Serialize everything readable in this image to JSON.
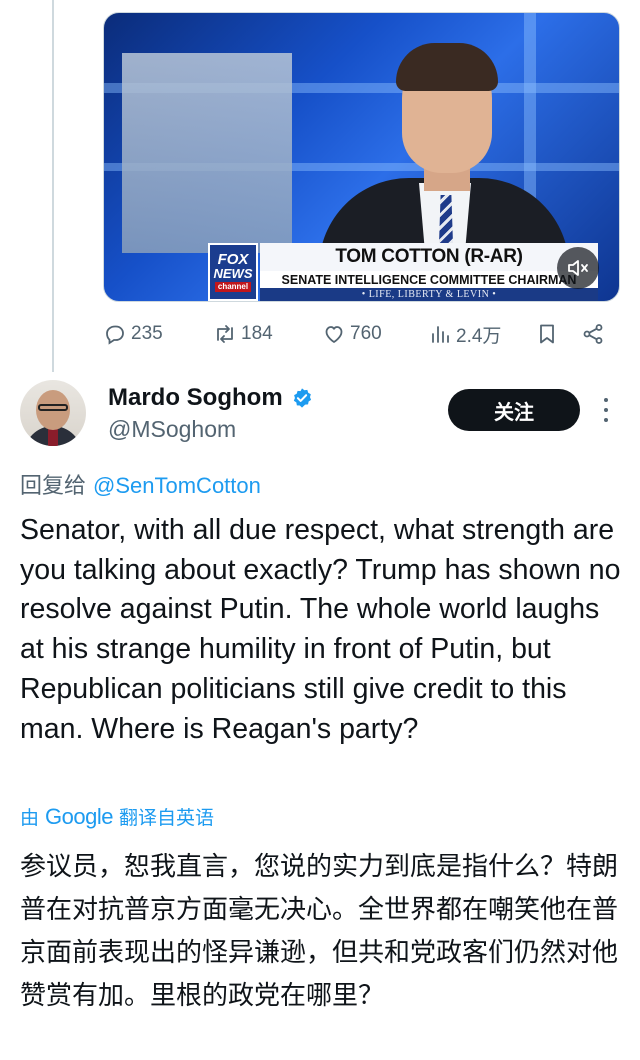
{
  "media": {
    "lower_third": {
      "name": "TOM COTTON (R-AR)",
      "title": "SENATE INTELLIGENCE COMMITTEE CHAIRMAN",
      "show": "• LIFE, LIBERTY & LEVIN •"
    },
    "network_logo": {
      "line1": "FOX",
      "line2": "NEWS",
      "line3": "channel"
    },
    "mute_icon": "speaker-muted-icon"
  },
  "actions": {
    "replies": "235",
    "reposts": "184",
    "likes": "760",
    "views": "2.4万"
  },
  "reply": {
    "display_name": "Mardo Soghom",
    "handle": "@MSoghom",
    "verified": true,
    "follow_label": "关注",
    "reply_to_prefix": "回复给",
    "reply_to_mention": "@SenTomCotton",
    "text": "Senator, with all due respect, what strength are you talking about exactly? Trump has shown no resolve against Putin. The whole world laughs at his strange humility in front of Putin, but Republican politicians still give credit to this man. Where is Reagan's party?",
    "translated_prefix": "由",
    "translated_by": "Google",
    "translated_suffix": "翻译自英语",
    "translation": "参议员，恕我直言，您说的实力到底是指什么？特朗普在对抗普京方面毫无决心。全世界都在嘲笑他在普京面前表现出的怪异谦逊，但共和党政客们仍然对他赞赏有加。里根的政党在哪里？"
  },
  "colors": {
    "accent": "#1d9bf0",
    "text_primary": "#0f1419",
    "text_secondary": "#536471",
    "follow_bg": "#0f1419"
  }
}
